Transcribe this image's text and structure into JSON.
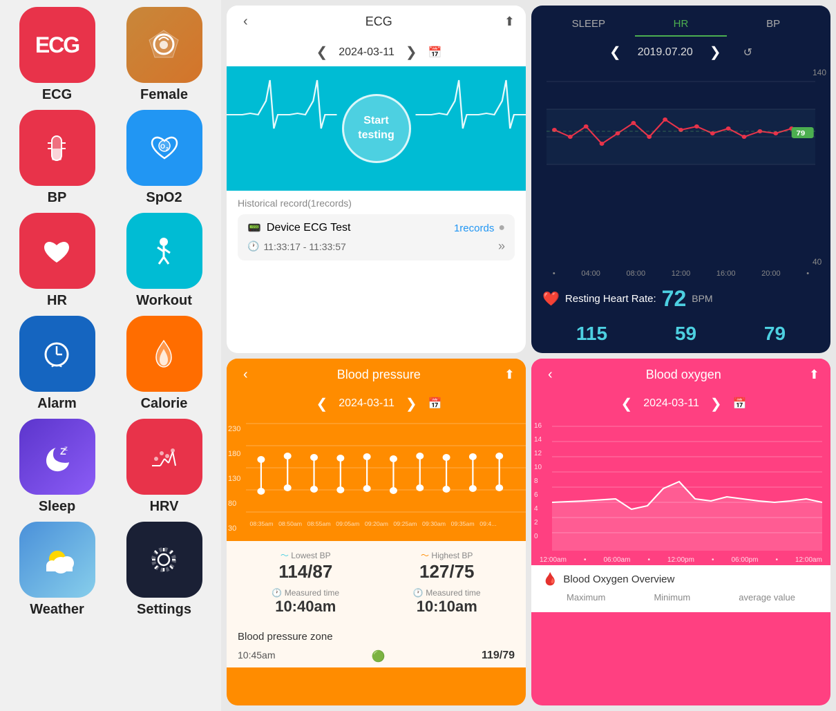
{
  "sidebar": {
    "items": [
      {
        "id": "ecg",
        "label": "ECG",
        "icon": "ECG",
        "bg": "bg-red",
        "emoji": "📊"
      },
      {
        "id": "female",
        "label": "Female",
        "icon": "♥",
        "bg": "bg-orange-brown",
        "emoji": "🫀"
      },
      {
        "id": "bp",
        "label": "BP",
        "icon": "🌡",
        "bg": "bg-pink",
        "emoji": "🌡"
      },
      {
        "id": "spo2",
        "label": "SpO2",
        "icon": "O₂",
        "bg": "bg-blue",
        "emoji": "💧"
      },
      {
        "id": "hr",
        "label": "HR",
        "icon": "♥",
        "bg": "bg-pink2",
        "emoji": "❤"
      },
      {
        "id": "workout",
        "label": "Workout",
        "icon": "🏃",
        "bg": "bg-teal",
        "emoji": "🏃"
      },
      {
        "id": "alarm",
        "label": "Alarm",
        "icon": "⏰",
        "bg": "bg-blue2",
        "emoji": "⏰"
      },
      {
        "id": "calorie",
        "label": "Calorie",
        "icon": "🔥",
        "bg": "bg-orange",
        "emoji": "🔥"
      },
      {
        "id": "sleep",
        "label": "Sleep",
        "icon": "🌙",
        "bg": "bg-purple",
        "emoji": "🌙"
      },
      {
        "id": "hrv",
        "label": "HRV",
        "icon": "📈",
        "bg": "bg-pink3",
        "emoji": "📈"
      },
      {
        "id": "weather",
        "label": "Weather",
        "icon": "⛅",
        "bg": "bg-weather",
        "emoji": "⛅"
      },
      {
        "id": "settings",
        "label": "Settings",
        "icon": "⚙",
        "bg": "bg-dark",
        "emoji": "⚙"
      }
    ]
  },
  "ecg_panel": {
    "title": "ECG",
    "date": "2024-03-11",
    "start_btn": "Start\ntesting",
    "historical_label": "Historical record(1records)",
    "device_test": "Device ECG Test",
    "records_count": "1records",
    "time_range": "11:33:17 - 11:33:57"
  },
  "hr_panel": {
    "tabs": [
      "SLEEP",
      "HR",
      "BP"
    ],
    "active_tab": "HR",
    "date": "2019.07.20",
    "y_max": "140",
    "y_min": "40",
    "time_labels": [
      "04:00",
      "08:00",
      "12:00",
      "16:00",
      "20:00"
    ],
    "resting_label": "Resting Heart Rate:",
    "resting_value": "72",
    "resting_unit": "BPM",
    "stats": [
      "115",
      "59",
      "79"
    ],
    "hr_badge": "79"
  },
  "bp_panel": {
    "title": "Blood pressure",
    "date": "2024-03-11",
    "y_labels": [
      "230",
      "180",
      "130",
      "80",
      "30"
    ],
    "time_labels": [
      "08:35am",
      "08:50am",
      "08:55am",
      "09:05am",
      "09:20am",
      "09:25am",
      "09:30am",
      "09:35am",
      "09:4..."
    ],
    "lowest_label": "Lowest BP",
    "lowest_value": "114/87",
    "highest_label": "Highest BP",
    "highest_value": "127/75",
    "lowest_time_label": "Measured time",
    "lowest_time": "10:40am",
    "highest_time_label": "Measured time",
    "highest_time": "10:10am",
    "zone_title": "Blood pressure zone",
    "zone_entry_time": "10:45am",
    "zone_entry_value": "119/79"
  },
  "bo_panel": {
    "title": "Blood oxygen",
    "date": "2024-03-11",
    "y_labels": [
      "16",
      "14",
      "12",
      "10",
      "8",
      "6",
      "4",
      "2",
      "0"
    ],
    "x_labels": [
      "12:00am",
      "06:00am",
      "12:00pm",
      "06:00pm",
      "12:00am"
    ],
    "overview_title": "Blood Oxygen Overview",
    "col_headers": [
      "Maximum",
      "Minimum",
      "average value"
    ]
  }
}
